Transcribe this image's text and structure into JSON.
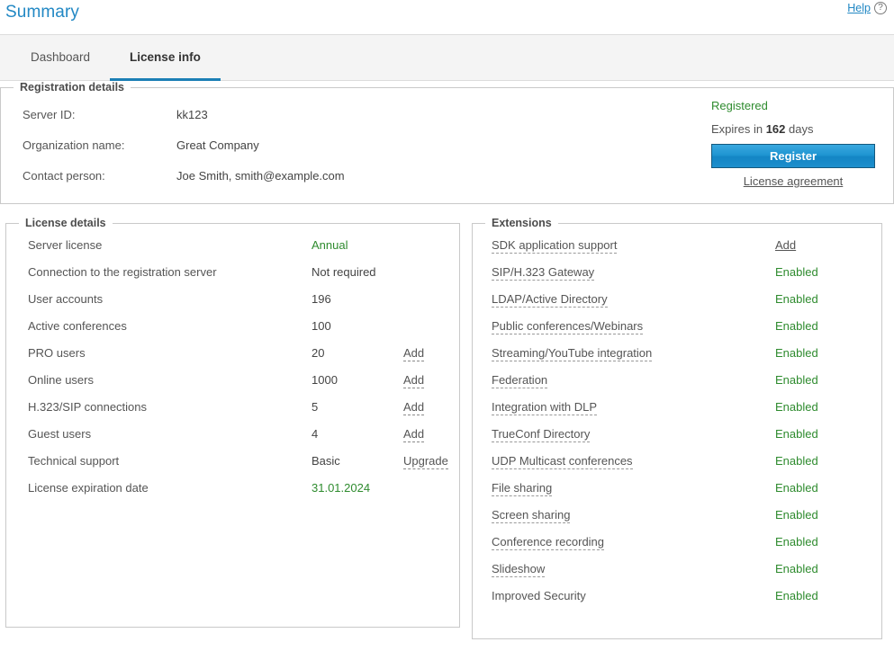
{
  "header": {
    "title": "Summary",
    "help_label": "Help",
    "help_icon": "question-circle-icon"
  },
  "tabs": [
    {
      "label": "Dashboard",
      "active": false
    },
    {
      "label": "License info",
      "active": true
    }
  ],
  "registration": {
    "legend": "Registration details",
    "rows": [
      {
        "label": "Server ID:",
        "value": "kk123"
      },
      {
        "label": "Organization name:",
        "value": "Great Company"
      },
      {
        "label": "Contact person:",
        "value": "Joe Smith, smith@example.com"
      }
    ],
    "status": "Registered",
    "expires_prefix": "Expires in ",
    "expires_days": "162",
    "expires_suffix": " days",
    "register_button": "Register",
    "license_agreement": "License agreement",
    "status_color": "#2e8b2e",
    "button_color": "#1f95d2"
  },
  "license_details": {
    "legend": "License details",
    "rows": [
      {
        "label": "Server license",
        "value": "Annual",
        "green": true,
        "action": ""
      },
      {
        "label": "Connection to the registration server",
        "value": "Not required",
        "green": false,
        "action": ""
      },
      {
        "label": "User accounts",
        "value": "196",
        "green": false,
        "action": ""
      },
      {
        "label": "Active conferences",
        "value": "100",
        "green": false,
        "action": ""
      },
      {
        "label": "PRO users",
        "value": "20",
        "green": false,
        "action": "Add"
      },
      {
        "label": "Online users",
        "value": "1000",
        "green": false,
        "action": "Add"
      },
      {
        "label": "H.323/SIP connections",
        "value": "5",
        "green": false,
        "action": "Add"
      },
      {
        "label": "Guest users",
        "value": "4",
        "green": false,
        "action": "Add"
      },
      {
        "label": "Technical support",
        "value": "Basic",
        "green": false,
        "action": "Upgrade"
      },
      {
        "label": "License expiration date",
        "value": "31.01.2024",
        "green": true,
        "action": ""
      }
    ]
  },
  "extensions": {
    "legend": "Extensions",
    "rows": [
      {
        "label": "SDK application support",
        "value": "Add",
        "is_link": true,
        "dashed": true
      },
      {
        "label": "SIP/H.323 Gateway",
        "value": "Enabled",
        "is_link": false,
        "dashed": true
      },
      {
        "label": "LDAP/Active Directory",
        "value": "Enabled",
        "is_link": false,
        "dashed": true
      },
      {
        "label": "Public conferences/Webinars",
        "value": "Enabled",
        "is_link": false,
        "dashed": true
      },
      {
        "label": "Streaming/YouTube integration",
        "value": "Enabled",
        "is_link": false,
        "dashed": true
      },
      {
        "label": "Federation",
        "value": "Enabled",
        "is_link": false,
        "dashed": true
      },
      {
        "label": "Integration with DLP",
        "value": "Enabled",
        "is_link": false,
        "dashed": true
      },
      {
        "label": "TrueConf Directory",
        "value": "Enabled",
        "is_link": false,
        "dashed": true
      },
      {
        "label": "UDP Multicast conferences",
        "value": "Enabled",
        "is_link": false,
        "dashed": true
      },
      {
        "label": "File sharing",
        "value": "Enabled",
        "is_link": false,
        "dashed": true
      },
      {
        "label": "Screen sharing",
        "value": "Enabled",
        "is_link": false,
        "dashed": true
      },
      {
        "label": "Conference recording",
        "value": "Enabled",
        "is_link": false,
        "dashed": true
      },
      {
        "label": "Slideshow",
        "value": "Enabled",
        "is_link": false,
        "dashed": true
      },
      {
        "label": "Improved Security",
        "value": "Enabled",
        "is_link": false,
        "dashed": false
      }
    ],
    "enabled_color": "#2e8b2e"
  }
}
